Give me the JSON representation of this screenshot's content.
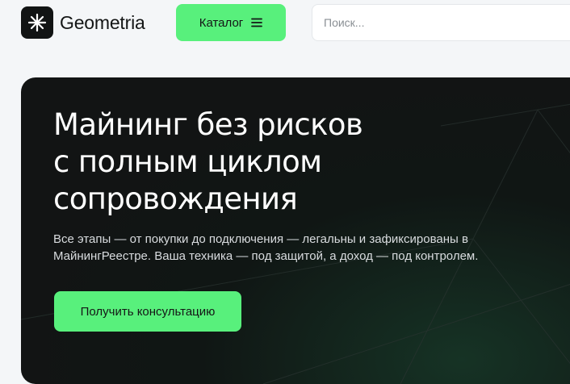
{
  "header": {
    "logo_text": "Geometria",
    "catalog_label": "Каталог",
    "search_placeholder": "Поиск..."
  },
  "hero": {
    "title_lines": [
      "Майнинг без рисков",
      "с полным циклом",
      "сопровождения"
    ],
    "description_lines": [
      "Все этапы — от покупки до подключения — легальны и зафиксированы в",
      "МайнингРеестре. Ваша техника — под защитой, а доход — под контролем."
    ],
    "cta_label": "Получить консультацию"
  },
  "colors": {
    "accent": "#58f07c",
    "hero_bg": "#121414",
    "page_bg": "#f4f6f8"
  }
}
